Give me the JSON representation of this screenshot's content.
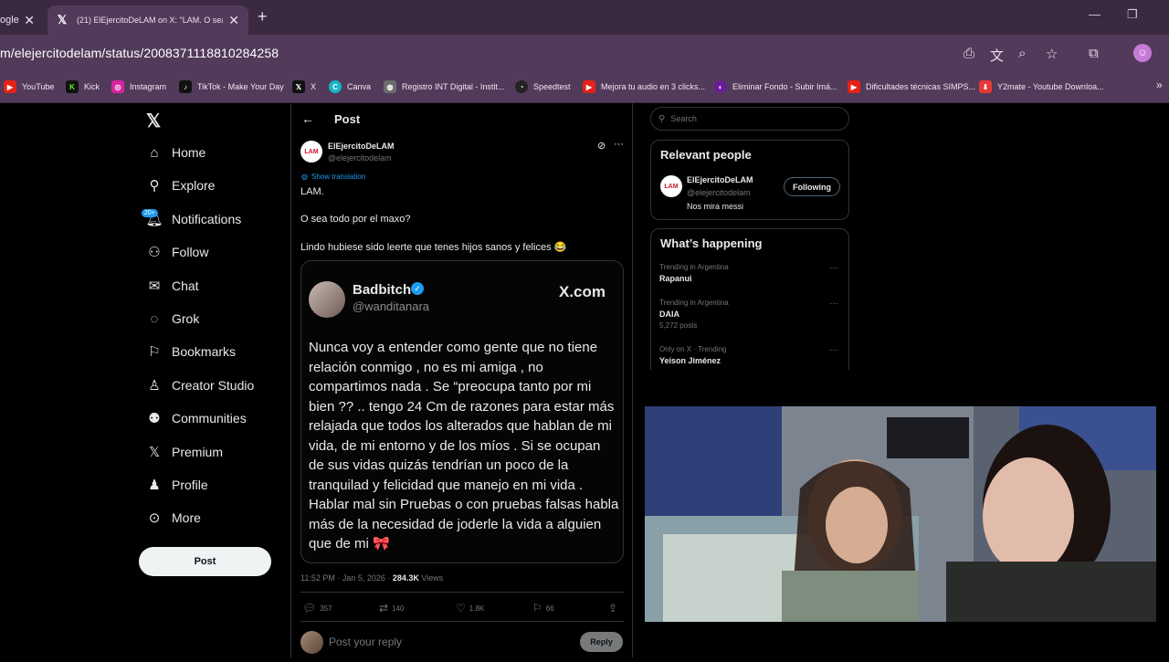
{
  "browser": {
    "tab1_label": "ogle",
    "tab2_label": "(21) ElEjercitoDeLAM on X: \"LAM. O sea to",
    "url": "m/elejercitodelam/status/2008371118810284258",
    "bookmarks": [
      "YouTube",
      "Kick",
      "Instagram",
      "TikTok - Make Your Day",
      "X",
      "Canva",
      "Registro INT Digital - Instit...",
      "Speedtest",
      "Mejora tu audio en 3 clicks...",
      "Eliminar Fondo - Subir Imá...",
      "Dificultades técnicas SIMPS...",
      "Y2mate - Youtube Downloa..."
    ]
  },
  "nav": {
    "items": [
      "Home",
      "Explore",
      "Notifications",
      "Follow",
      "Chat",
      "Grok",
      "Bookmarks",
      "Creator Studio",
      "Communities",
      "Premium",
      "Profile",
      "More"
    ],
    "badge": "20+",
    "post_button": "Post"
  },
  "post": {
    "header": "Post",
    "author_name": "ElEjercitoDeLAM",
    "author_handle": "@elejercitodelam",
    "avatar_text": "LAM",
    "show_translation": "Show translation",
    "line1": "LAM.",
    "line2": "O sea todo por el maxo?",
    "line3": "Lindo hubiese sido  leerte que tenes hijos sanos y felices 😂",
    "quote": {
      "name": "Badbitch",
      "handle": "@wanditanara",
      "brand": "X.com",
      "text": "Nunca voy a entender como gente que no tiene relación conmigo , no es mi amiga , no compartimos nada . Se “preocupa tanto por mi bien ?? ..  tengo 24 Cm de razones para estar más relajada que todos los alterados que hablan de mi vida, de mi entorno y de los míos . Si se ocupan de sus vidas quizás tendrían un poco de la tranquilad y felicidad que manejo en mi vida . Hablar mal sin Pruebas o con pruebas falsas habla más de la necesidad de joderle la vida a alguien que de mi 🎀"
    },
    "timestamp": "11:52 PM · Jan 5, 2026 · ",
    "views_count": "284.3K",
    "views_label": " Views",
    "replies": "357",
    "reposts": "140",
    "likes": "1.8K",
    "bookmarks": "66",
    "reply_placeholder": "Post your reply",
    "reply_button": "Reply"
  },
  "right": {
    "search_placeholder": "Search",
    "relevant_title": "Relevant people",
    "rp_name": "ElEjercitoDeLAM",
    "rp_handle": "@elejercitodelam",
    "rp_bio": "Nos mira messi",
    "following": "Following",
    "happening_title": "What’s happening",
    "trends": [
      {
        "context": "Trending in Argentina",
        "name": "Rapanui",
        "posts": ""
      },
      {
        "context": "Trending in Argentina",
        "name": "DAIA",
        "posts": "5,272 posts"
      },
      {
        "context": "Only on X · Trending",
        "name": "Yeison Jiménez",
        "posts": ""
      }
    ]
  }
}
